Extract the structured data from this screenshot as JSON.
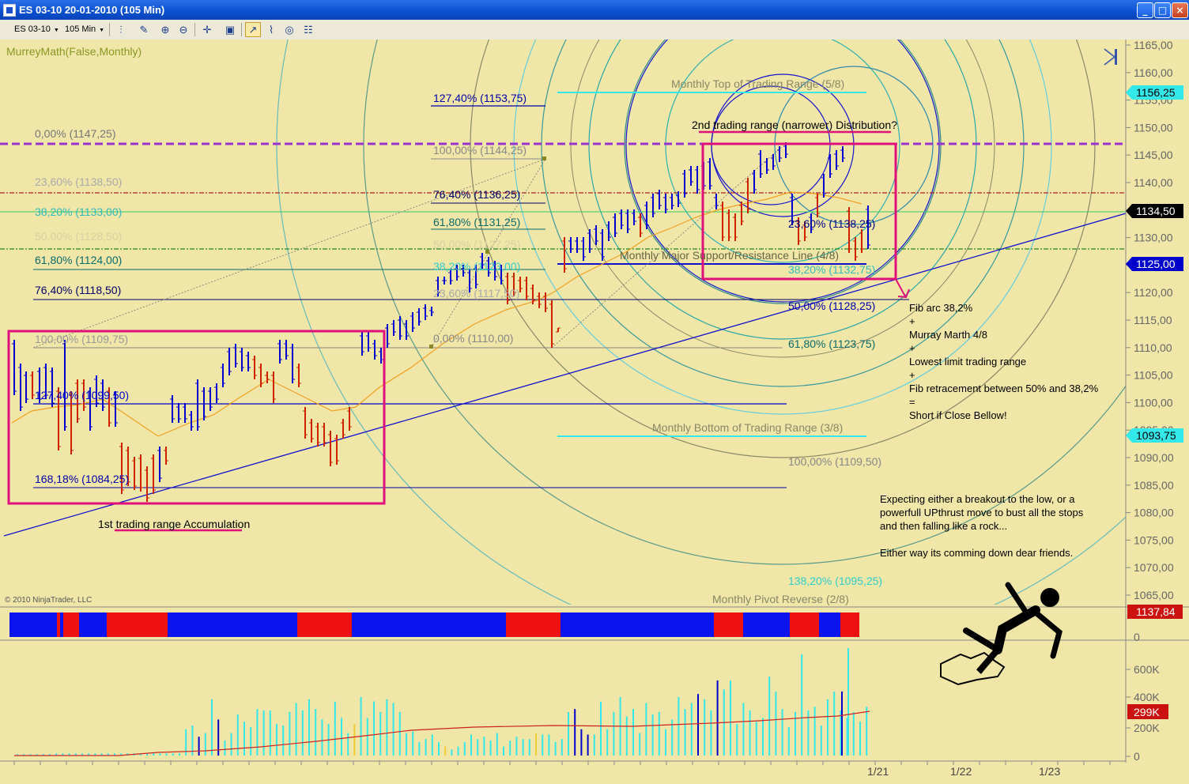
{
  "window": {
    "title": "ES 03-10  20-01-2010 (105 Min)",
    "min_glyph": "_",
    "max_glyph": "□",
    "close_glyph": "×"
  },
  "toolbar": {
    "instrument": "ES 03-10",
    "period": "105 Min",
    "icons": [
      "bar-style-icon",
      "drawing-tool-icon",
      "zoom-in-icon",
      "zoom-out-icon",
      "crosshair-icon",
      "properties-icon",
      "indicators-icon",
      "strategies-icon",
      "data-box-icon",
      "chart-trader-icon"
    ]
  },
  "indicator_label": "MurreyMath(False,Monthly)",
  "copyright": "© 2010 NinjaTrader, LLC",
  "price_axis": {
    "ticks": [
      "1165,00",
      "1160,00",
      "1155,00",
      "1150,00",
      "1145,00",
      "1140,00",
      "1135,00",
      "1130,00",
      "1125,00",
      "1120,00",
      "1115,00",
      "1110,00",
      "1105,00",
      "1100,00",
      "1095,00",
      "1090,00",
      "1085,00",
      "1080,00",
      "1075,00",
      "1070,00",
      "1065,00"
    ],
    "markers": [
      {
        "label": "1156,25",
        "color": "#33e8e8",
        "text": "#000000"
      },
      {
        "label": "1134,50",
        "color": "#000000",
        "text": "#ffffff"
      },
      {
        "label": "1125,00",
        "color": "#0000cc",
        "text": "#ffffff"
      },
      {
        "label": "1093,75",
        "color": "#33e8e8",
        "text": "#000000"
      }
    ]
  },
  "fib_left": [
    "0,00% (1147,25)",
    "23,60% (1138,50)",
    "38,20% (1133,00)",
    "50,00% (1128,50)",
    "61,80% (1124,00)",
    "76,40% (1118,50)",
    "100,00% (1109,75)",
    "127,40% (1099,50)",
    "168,18% (1084,25)"
  ],
  "fib_mid": [
    "127,40% (1153,75)",
    "100,00% (1144,25)",
    "76,40% (1136,25)",
    "61,80% (1131,25)",
    "50,00% (1127,25)",
    "38,20% (1123,00)",
    "23,60% (1117,50)",
    "0,00% (1110,00)"
  ],
  "fib_right": [
    "23,60% (1138,25)",
    "38,20% (1132,75)",
    "50,00% (1128,25)",
    "61,80% (1123,75)",
    "100,00% (1109,50)",
    "138,20% (1095,25)"
  ],
  "murrey": {
    "top": "Monthly Top of Trading Range (5/8)",
    "major": "Monthly Major Support/Resistance Line (4/8)",
    "bottom": "Monthly Bottom of Trading Range (3/8)",
    "pivot": "Monthly Pivot  Reverse (2/8)"
  },
  "annotations": {
    "range2": "2nd trading range (narrower) Distribution?",
    "range1": "1st trading range Accumulation",
    "notes": [
      "Fib arc 38,2%",
      "+",
      "Murray Marth 4/8",
      "+",
      "Lowest limit trading range",
      "+",
      "Fib retracement between 50% and 38,2%",
      "=",
      "Short if Close Bellow!"
    ],
    "expect": [
      "Expecting either a breakout to the low, or a",
      "powerfull UPthrust move to bust all the stops",
      "and then falling like a rock..."
    ],
    "either": "Either way its comming down dear friends."
  },
  "panel2": {
    "value": "1137,84",
    "zero": "0",
    "blocks": [
      {
        "color": "blue",
        "w": 60
      },
      {
        "color": "red",
        "w": 4
      },
      {
        "color": "blue",
        "w": 4
      },
      {
        "color": "red",
        "w": 20
      },
      {
        "color": "blue",
        "w": 35
      },
      {
        "color": "red",
        "w": 77
      },
      {
        "color": "blue",
        "w": 164
      },
      {
        "color": "red",
        "w": 69
      },
      {
        "color": "blue",
        "w": 195
      },
      {
        "color": "red",
        "w": 69
      },
      {
        "color": "blue",
        "w": 194
      },
      {
        "color": "red",
        "w": 37
      },
      {
        "color": "blue",
        "w": 59
      },
      {
        "color": "red",
        "w": 37
      },
      {
        "color": "blue",
        "w": 27
      },
      {
        "color": "red",
        "w": 24
      }
    ]
  },
  "volume_axis": {
    "ticks": [
      "600K",
      "400K",
      "200K",
      "0"
    ],
    "marker": "299K"
  },
  "time_axis": [
    "1/21",
    "1/22",
    "1/23"
  ],
  "colors": {
    "bg": "#efe6a8",
    "up": "#0000cc",
    "down": "#cc2200",
    "box": "#e0107a",
    "fib": "#0000aa",
    "cyan": "#33d6d6"
  }
}
